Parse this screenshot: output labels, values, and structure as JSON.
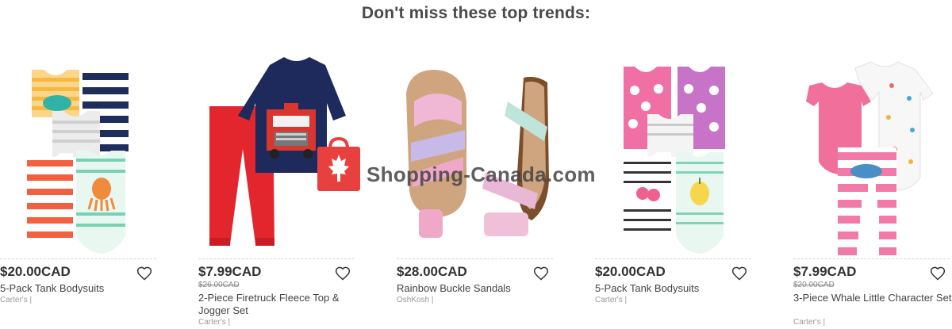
{
  "heading": "Don't miss these top trends:",
  "watermark": {
    "text": "Shopping-Canada.com"
  },
  "products": [
    {
      "price": "$20.00CAD",
      "was": "",
      "name": "5-Pack Tank Bodysuits",
      "brand": "Carter's |"
    },
    {
      "price": "$7.99CAD",
      "was": "$26.00CAD",
      "name": "2-Piece Firetruck Fleece Top & Jogger Set",
      "brand": "Carter's |"
    },
    {
      "price": "$28.00CAD",
      "was": "",
      "name": "Rainbow Buckle Sandals",
      "brand": "OshKosh |"
    },
    {
      "price": "$20.00CAD",
      "was": "",
      "name": "5-Pack Tank Bodysuits",
      "brand": "Carter's |"
    },
    {
      "price": "$7.99CAD",
      "was": "$20.00CAD",
      "name": "3-Piece Whale Little Character Set",
      "brand": "Carter's |"
    }
  ],
  "images": [
    "tank-bodysuits-image",
    "firetruck-set-image",
    "rainbow-sandals-image",
    "tank-bodysuits-image",
    "whale-set-image"
  ],
  "icons": {
    "wishlist": "heart-icon",
    "watermark_logo": "maple-leaf-bag-icon"
  },
  "colors": {
    "watermark_red": "#e8403f",
    "text": "#333333",
    "was_price": "#888888"
  }
}
